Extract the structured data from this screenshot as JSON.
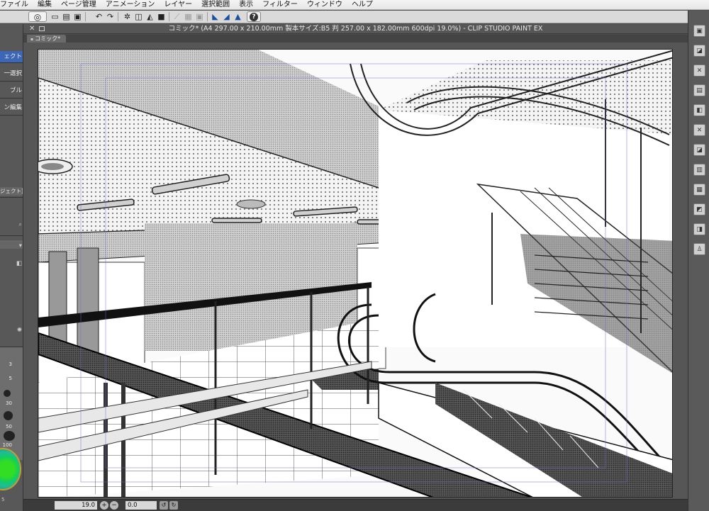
{
  "menu": [
    "ファイル",
    "編集",
    "ページ管理",
    "アニメーション",
    "レイヤー",
    "選択範囲",
    "表示",
    "フィルター",
    "ウィンドウ",
    "ヘルプ"
  ],
  "document": {
    "title": "コミック* (A4 297.00 x 210.00mm 製本サイズ:B5 判 257.00 x 182.00mm 600dpi 19.0%)  - CLIP STUDIO PAINT EX",
    "tab": "コミック*"
  },
  "left_panel": {
    "items": [
      "ェクト",
      "一選択",
      "ブル",
      "ン編集"
    ],
    "layer_label": "ジェクト]",
    "brush_sizes": [
      "3",
      "5",
      "30",
      "50",
      "100"
    ],
    "bottom_number": "5"
  },
  "status": {
    "zoom": "19.0",
    "rotation": "0.0"
  },
  "colors": {
    "menubar": "#ececec",
    "panel": "#585858",
    "selection_accent": "#3d66b5",
    "canvas_bg": "#ffffff"
  },
  "icons": {
    "toolbar": [
      "clip-studio-logo-icon",
      "new-file-icon",
      "open-file-icon",
      "save-icon",
      "undo-icon",
      "redo-icon",
      "transform-icon",
      "erase-icon",
      "fill-icon",
      "ruler-icon",
      "snap-icon",
      "help-icon"
    ],
    "right_dock": [
      "navigator-icon",
      "material-icon",
      "layer-property-icon",
      "layer-icon",
      "color-icon",
      "subview-icon",
      "history-icon",
      "animation-icon",
      "search-icon",
      "info-icon",
      "timeline-icon",
      "figure-icon"
    ]
  }
}
